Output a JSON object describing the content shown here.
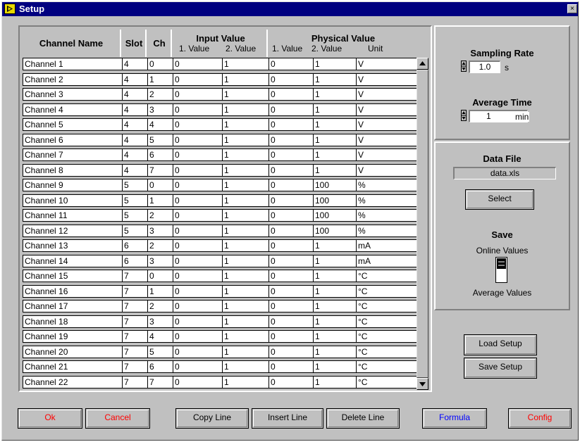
{
  "window": {
    "title": "Setup",
    "close_label": "×"
  },
  "table": {
    "headers": {
      "channel_name": "Channel Name",
      "slot": "Slot",
      "ch": "Ch",
      "input_value": "Input Value",
      "input_sub1": "1. Value",
      "input_sub2": "2. Value",
      "physical_value": "Physical Value",
      "phys_sub1": "1. Value",
      "phys_sub2": "2. Value",
      "unit": "Unit"
    },
    "rows": [
      [
        "Channel 1",
        "4",
        "0",
        "0",
        "1",
        "0",
        "1",
        "V"
      ],
      [
        "Channel 2",
        "4",
        "1",
        "0",
        "1",
        "0",
        "1",
        "V"
      ],
      [
        "Channel 3",
        "4",
        "2",
        "0",
        "1",
        "0",
        "1",
        "V"
      ],
      [
        "Channel 4",
        "4",
        "3",
        "0",
        "1",
        "0",
        "1",
        "V"
      ],
      [
        "Channel 5",
        "4",
        "4",
        "0",
        "1",
        "0",
        "1",
        "V"
      ],
      [
        "Channel 6",
        "4",
        "5",
        "0",
        "1",
        "0",
        "1",
        "V"
      ],
      [
        "Channel 7",
        "4",
        "6",
        "0",
        "1",
        "0",
        "1",
        "V"
      ],
      [
        "Channel 8",
        "4",
        "7",
        "0",
        "1",
        "0",
        "1",
        "V"
      ],
      [
        "Channel 9",
        "5",
        "0",
        "0",
        "1",
        "0",
        "100",
        "%"
      ],
      [
        "Channel 10",
        "5",
        "1",
        "0",
        "1",
        "0",
        "100",
        "%"
      ],
      [
        "Channel 11",
        "5",
        "2",
        "0",
        "1",
        "0",
        "100",
        "%"
      ],
      [
        "Channel 12",
        "5",
        "3",
        "0",
        "1",
        "0",
        "100",
        "%"
      ],
      [
        "Channel 13",
        "6",
        "2",
        "0",
        "1",
        "0",
        "1",
        "mA"
      ],
      [
        "Channel 14",
        "6",
        "3",
        "0",
        "1",
        "0",
        "1",
        "mA"
      ],
      [
        "Channel 15",
        "7",
        "0",
        "0",
        "1",
        "0",
        "1",
        "°C"
      ],
      [
        "Channel 16",
        "7",
        "1",
        "0",
        "1",
        "0",
        "1",
        "°C"
      ],
      [
        "Channel 17",
        "7",
        "2",
        "0",
        "1",
        "0",
        "1",
        "°C"
      ],
      [
        "Channel 18",
        "7",
        "3",
        "0",
        "1",
        "0",
        "1",
        "°C"
      ],
      [
        "Channel 19",
        "7",
        "4",
        "0",
        "1",
        "0",
        "1",
        "°C"
      ],
      [
        "Channel 20",
        "7",
        "5",
        "0",
        "1",
        "0",
        "1",
        "°C"
      ],
      [
        "Channel 21",
        "7",
        "6",
        "0",
        "1",
        "0",
        "1",
        "°C"
      ],
      [
        "Channel 22",
        "7",
        "7",
        "0",
        "1",
        "0",
        "1",
        "°C"
      ]
    ]
  },
  "sampling": {
    "title": "Sampling Rate",
    "value": "1.0",
    "unit": "s",
    "avg_title": "Average Time",
    "avg_value": "1",
    "avg_unit": "min"
  },
  "datafile": {
    "title": "Data File",
    "filename": "data.xls",
    "select_label": "Select",
    "save_title": "Save",
    "online_label": "Online Values",
    "average_label": "Average Values"
  },
  "setup_buttons": {
    "load": "Load Setup",
    "save": "Save Setup"
  },
  "bottom_buttons": {
    "ok": "Ok",
    "cancel": "Cancel",
    "copy_line": "Copy Line",
    "insert_line": "Insert Line",
    "delete_line": "Delete Line",
    "formula": "Formula",
    "config": "Config"
  },
  "colors": {
    "title_bar": "#000080",
    "ok_text": "#ff0000",
    "cancel_text": "#ff0000",
    "formula_text": "#0000ff",
    "config_text": "#ff0000",
    "face": "#c0c0c0"
  },
  "icons": {
    "title": "labview-run-icon",
    "close": "close-icon"
  }
}
